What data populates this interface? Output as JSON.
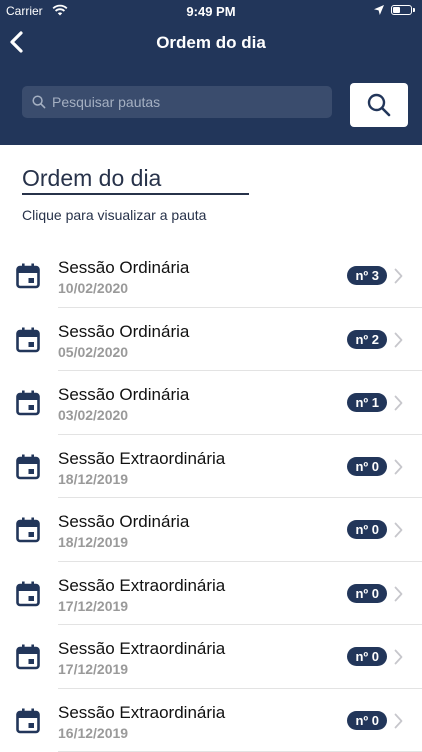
{
  "status_bar": {
    "carrier": "Carrier",
    "time": "9:49 PM"
  },
  "header": {
    "title": "Ordem do dia"
  },
  "search": {
    "placeholder": "Pesquisar pautas"
  },
  "section": {
    "title": "Ordem do dia",
    "subtitle": "Clique para visualizar a pauta"
  },
  "colors": {
    "header_bg": "#22365a",
    "badge_bg": "#22365a",
    "accent": "#27324a"
  },
  "items": [
    {
      "title": "Sessão Ordinária",
      "date": "10/02/2020",
      "badge": "nº 3"
    },
    {
      "title": "Sessão Ordinária",
      "date": "05/02/2020",
      "badge": "nº 2"
    },
    {
      "title": "Sessão Ordinária",
      "date": "03/02/2020",
      "badge": "nº 1"
    },
    {
      "title": "Sessão Extraordinária",
      "date": "18/12/2019",
      "badge": "nº 0"
    },
    {
      "title": "Sessão Ordinária",
      "date": "18/12/2019",
      "badge": "nº 0"
    },
    {
      "title": "Sessão Extraordinária",
      "date": "17/12/2019",
      "badge": "nº 0"
    },
    {
      "title": "Sessão Extraordinária",
      "date": "17/12/2019",
      "badge": "nº 0"
    },
    {
      "title": "Sessão Extraordinária",
      "date": "16/12/2019",
      "badge": "nº 0"
    }
  ]
}
